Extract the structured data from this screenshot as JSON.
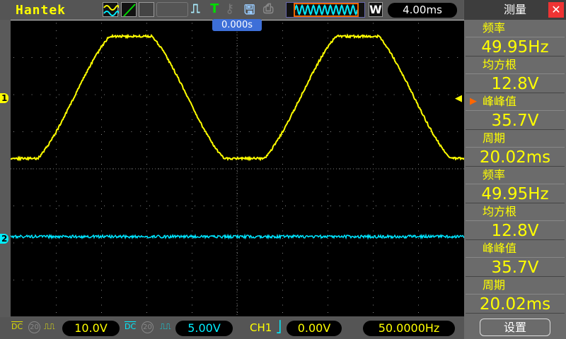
{
  "header": {
    "brand": "Hantek",
    "timebase": "4.00ms",
    "trigger_pos": "0.000s",
    "w_label": "W"
  },
  "side": {
    "title": "测量",
    "close": "✕",
    "settings": "设置",
    "items": [
      {
        "label": "频率",
        "value": "49.95Hz"
      },
      {
        "label": "均方根",
        "value": "12.8V"
      },
      {
        "label": "峰峰值",
        "value": "35.7V",
        "selected": true
      },
      {
        "label": "周期",
        "value": "20.02ms"
      },
      {
        "label": "频率",
        "value": "49.95Hz"
      },
      {
        "label": "均方根",
        "value": "12.8V"
      },
      {
        "label": "峰峰值",
        "value": "35.7V"
      },
      {
        "label": "周期",
        "value": "20.02ms"
      }
    ]
  },
  "bottom": {
    "ch1_coupling": "DC",
    "ch1_bw": "20",
    "ch1_scale": "10.0V",
    "ch2_coupling": "DC",
    "ch2_bw": "20",
    "ch2_scale": "5.00V",
    "trig_source": "CH1",
    "trig_level": "0.00V",
    "trig_freq": "50.0000Hz"
  },
  "markers": {
    "ch1": "1",
    "ch2": "2"
  },
  "colors": {
    "ch1": "#ffff00",
    "ch2": "#00e5ff",
    "accent": "#ff6600"
  }
}
